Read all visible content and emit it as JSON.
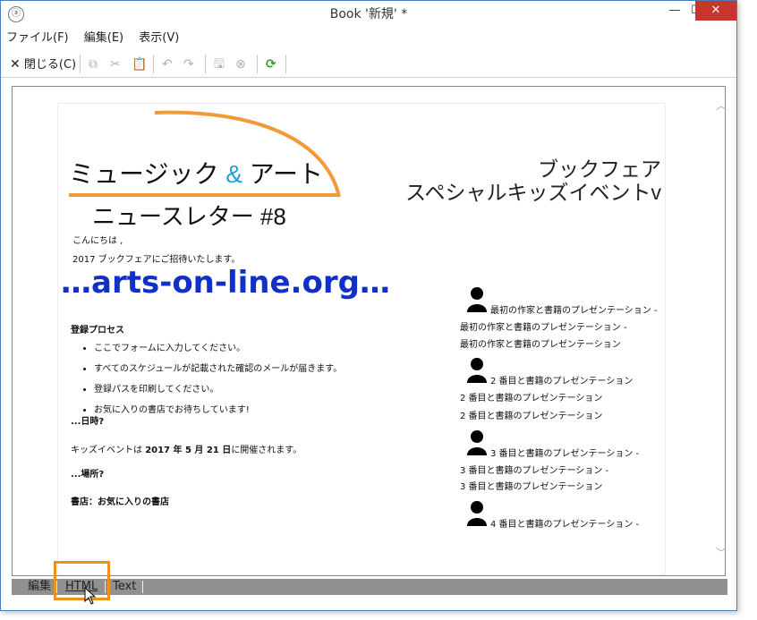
{
  "window": {
    "title": "Book '新規' *",
    "minimize": "—",
    "maximize": "☐",
    "close": "✕"
  },
  "menu": [
    "ファイル(F)",
    "編集(E)",
    "表示(V)"
  ],
  "toolbar": {
    "close_label": "閉じる(C)"
  },
  "document": {
    "header_left_line1_a": "ミュージック ",
    "header_left_amp": "&",
    "header_left_line1_b": " アート",
    "header_left_line2": "ニュースレター #8",
    "header_right_line1": "ブックフェア",
    "header_right_line2": "スペシャルキッズイベントv",
    "greeting": "こんにちは ,",
    "invite": "2017 ブックフェアにご招待いたします。",
    "site": "…arts-on-line.org…",
    "reg_title": "登録プロセス",
    "reg_items": [
      "ここでフォームに入力してください。",
      "すべてのスケジュールが記載された確認のメールが届きます。",
      "登録パスを印刷してください。",
      "お気に入りの書店でお待ちしています!"
    ],
    "when_title": "...日時?",
    "when_prefix": "キッズイベントは ",
    "when_date": "2017 年 5 月 21 日",
    "when_suffix": "に開催されます。",
    "where_title": "...場所?",
    "where_text": "書店：お気に入りの書店",
    "events": [
      {
        "line1": "最初の作家と書籍のプレゼンテーション -",
        "line2": "最初の作家と書籍のプレゼンテーション -",
        "line3": "最初の作家と書籍のプレゼンテーション"
      },
      {
        "line1": "2 番目と書籍のプレゼンテーション",
        "line2": "2 番目と書籍のプレゼンテーション",
        "line3": "2 番目と書籍のプレゼンテーション"
      },
      {
        "line1": "3 番目と書籍のプレゼンテーション -",
        "line2": "3 番目と書籍のプレゼンテーション -",
        "line3": "3 番目と書籍のプレゼンテーション"
      },
      {
        "line1": "4 番目と書籍のプレゼンテーション -"
      }
    ]
  },
  "tabs": [
    "編集",
    "HTML",
    "Text"
  ],
  "colors": {
    "accent_orange": "#f0901c",
    "arc_orange": "#f29a3a",
    "link_blue": "#1030c8",
    "amp_cyan": "#1fa3d6",
    "refresh_green": "#2e9e2e"
  }
}
